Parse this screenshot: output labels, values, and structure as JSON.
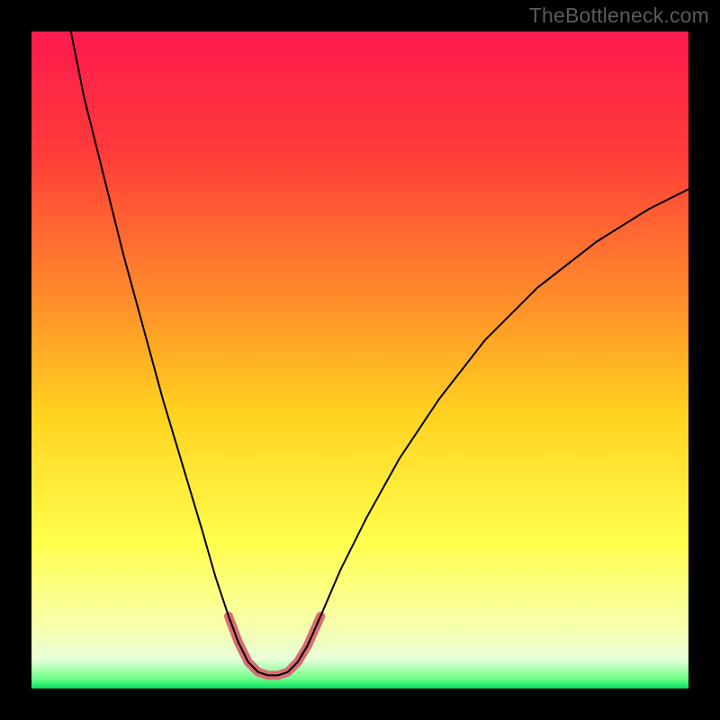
{
  "watermark": "TheBottleneck.com",
  "chart_data": {
    "type": "line",
    "title": "",
    "xlabel": "",
    "ylabel": "",
    "xlim": [
      0,
      100
    ],
    "ylim": [
      0,
      100
    ],
    "grid": false,
    "legend": false,
    "background_gradient_stops": [
      {
        "offset": 0.0,
        "color": "#ff1a4d"
      },
      {
        "offset": 0.18,
        "color": "#ff3a3a"
      },
      {
        "offset": 0.4,
        "color": "#ff8a2a"
      },
      {
        "offset": 0.58,
        "color": "#ffd21f"
      },
      {
        "offset": 0.78,
        "color": "#ffff4d"
      },
      {
        "offset": 0.9,
        "color": "#f8ffa8"
      },
      {
        "offset": 0.955,
        "color": "#e8ffd8"
      },
      {
        "offset": 0.985,
        "color": "#70ff8a"
      },
      {
        "offset": 1.0,
        "color": "#00e060"
      }
    ],
    "series": [
      {
        "name": "curve",
        "stroke": "#000000",
        "stroke_width": 2,
        "points": [
          {
            "x": 6.0,
            "y": 100.0
          },
          {
            "x": 8.0,
            "y": 90.0
          },
          {
            "x": 11.0,
            "y": 78.0
          },
          {
            "x": 14.0,
            "y": 66.0
          },
          {
            "x": 17.0,
            "y": 55.0
          },
          {
            "x": 20.0,
            "y": 44.0
          },
          {
            "x": 23.0,
            "y": 34.0
          },
          {
            "x": 26.0,
            "y": 24.0
          },
          {
            "x": 28.0,
            "y": 17.0
          },
          {
            "x": 30.0,
            "y": 11.0
          },
          {
            "x": 31.5,
            "y": 7.0
          },
          {
            "x": 33.0,
            "y": 4.0
          },
          {
            "x": 34.5,
            "y": 2.5
          },
          {
            "x": 36.0,
            "y": 2.0
          },
          {
            "x": 37.5,
            "y": 2.0
          },
          {
            "x": 39.0,
            "y": 2.5
          },
          {
            "x": 40.5,
            "y": 4.0
          },
          {
            "x": 42.0,
            "y": 6.5
          },
          {
            "x": 44.0,
            "y": 11.0
          },
          {
            "x": 47.0,
            "y": 18.0
          },
          {
            "x": 51.0,
            "y": 26.0
          },
          {
            "x": 56.0,
            "y": 35.0
          },
          {
            "x": 62.0,
            "y": 44.0
          },
          {
            "x": 69.0,
            "y": 53.0
          },
          {
            "x": 77.0,
            "y": 61.0
          },
          {
            "x": 86.0,
            "y": 68.0
          },
          {
            "x": 94.0,
            "y": 73.0
          },
          {
            "x": 100.0,
            "y": 76.0
          }
        ]
      }
    ],
    "highlight": {
      "stroke": "#d96b72",
      "stroke_width": 10,
      "points": [
        {
          "x": 30.0,
          "y": 11.0
        },
        {
          "x": 31.5,
          "y": 7.0
        },
        {
          "x": 33.0,
          "y": 4.0
        },
        {
          "x": 34.5,
          "y": 2.5
        },
        {
          "x": 36.0,
          "y": 2.0
        },
        {
          "x": 37.5,
          "y": 2.0
        },
        {
          "x": 39.0,
          "y": 2.5
        },
        {
          "x": 40.5,
          "y": 4.0
        },
        {
          "x": 42.0,
          "y": 6.5
        },
        {
          "x": 44.0,
          "y": 11.0
        }
      ]
    }
  }
}
